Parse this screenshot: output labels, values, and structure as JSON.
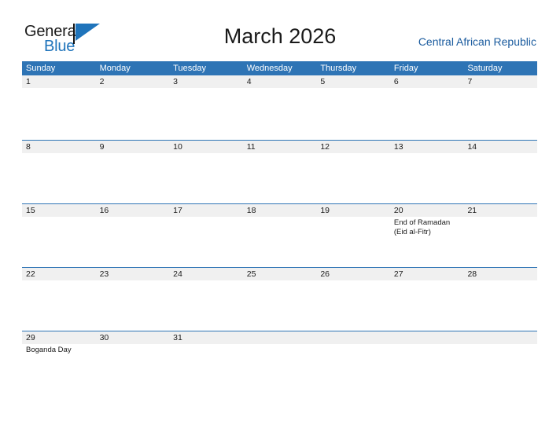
{
  "brand": {
    "name_part1": "General",
    "name_part2": "Blue",
    "flag_icon": "flag-icon"
  },
  "header": {
    "title": "March 2026",
    "country": "Central African Republic"
  },
  "colors": {
    "header_blue": "#2e74b5",
    "band_gray": "#f0f0f0",
    "brand_blue": "#1f74bb",
    "country_text": "#1a5b9e"
  },
  "calendar": {
    "weekdays": [
      "Sunday",
      "Monday",
      "Tuesday",
      "Wednesday",
      "Thursday",
      "Friday",
      "Saturday"
    ],
    "weeks": [
      {
        "days": [
          {
            "number": "1",
            "events": []
          },
          {
            "number": "2",
            "events": []
          },
          {
            "number": "3",
            "events": []
          },
          {
            "number": "4",
            "events": []
          },
          {
            "number": "5",
            "events": []
          },
          {
            "number": "6",
            "events": []
          },
          {
            "number": "7",
            "events": []
          }
        ]
      },
      {
        "days": [
          {
            "number": "8",
            "events": []
          },
          {
            "number": "9",
            "events": []
          },
          {
            "number": "10",
            "events": []
          },
          {
            "number": "11",
            "events": []
          },
          {
            "number": "12",
            "events": []
          },
          {
            "number": "13",
            "events": []
          },
          {
            "number": "14",
            "events": []
          }
        ]
      },
      {
        "days": [
          {
            "number": "15",
            "events": []
          },
          {
            "number": "16",
            "events": []
          },
          {
            "number": "17",
            "events": []
          },
          {
            "number": "18",
            "events": []
          },
          {
            "number": "19",
            "events": []
          },
          {
            "number": "20",
            "events": [
              "End of Ramadan",
              "(Eid al-Fitr)"
            ]
          },
          {
            "number": "21",
            "events": []
          }
        ]
      },
      {
        "days": [
          {
            "number": "22",
            "events": []
          },
          {
            "number": "23",
            "events": []
          },
          {
            "number": "24",
            "events": []
          },
          {
            "number": "25",
            "events": []
          },
          {
            "number": "26",
            "events": []
          },
          {
            "number": "27",
            "events": []
          },
          {
            "number": "28",
            "events": []
          }
        ]
      },
      {
        "days": [
          {
            "number": "29",
            "events": [
              "Boganda Day"
            ]
          },
          {
            "number": "30",
            "events": []
          },
          {
            "number": "31",
            "events": []
          },
          {
            "number": "",
            "events": []
          },
          {
            "number": "",
            "events": []
          },
          {
            "number": "",
            "events": []
          },
          {
            "number": "",
            "events": []
          }
        ]
      }
    ]
  }
}
